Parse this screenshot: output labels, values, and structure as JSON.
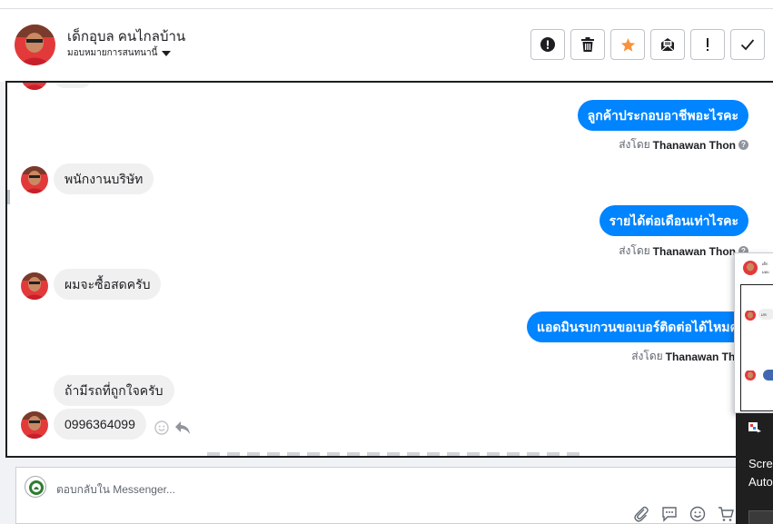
{
  "header": {
    "contact_name": "เด็กอุบล คนไกลบ้าน",
    "assign_label": "มอบหมายการสนทนานี้",
    "actions": [
      {
        "name": "report-spam-button",
        "icon": "exclamation-circle-icon"
      },
      {
        "name": "delete-button",
        "icon": "trash-icon"
      },
      {
        "name": "star-button",
        "icon": "star-icon",
        "color": "#f7923b"
      },
      {
        "name": "mark-unread-button",
        "icon": "envelope-open-icon"
      },
      {
        "name": "follow-up-button",
        "icon": "exclamation-icon"
      },
      {
        "name": "done-button",
        "icon": "checkmark-icon"
      }
    ]
  },
  "messages": [
    {
      "type": "out",
      "text": "ลูกค้าประกอบอาชีพอะไรคะ",
      "sender_prefix": "ส่งโดย",
      "sender_name": "Thanawan Thon"
    },
    {
      "type": "in",
      "text": "พนักงานบริษัท"
    },
    {
      "type": "out",
      "text": "รายได้ต่อเดือนเท่าไรคะ",
      "sender_prefix": "ส่งโดย",
      "sender_name": "Thanawan Thon"
    },
    {
      "type": "in",
      "text": "ผมจะซื้อสดครับ"
    },
    {
      "type": "out",
      "text": "แอดมินรบกวนขอเบอร์ติดต่อได้ไหมคะ",
      "sender_prefix": "ส่งโดย",
      "sender_name": "Thanawan Thon"
    },
    {
      "type": "in",
      "text": "ถ้ามีรถที่ถูกใจครับ"
    },
    {
      "type": "in",
      "text": "0996364099"
    }
  ],
  "composer": {
    "placeholder": "ตอบกลับใน Messenger...",
    "tools": [
      "paperclip-icon",
      "speech-bubble-icon",
      "smiley-icon",
      "cart-icon"
    ]
  },
  "popup": {
    "name_snippet": "เด็ก",
    "sub_snippet": "มอบ",
    "msg_snippet": "เสร"
  },
  "toast": {
    "line1": "Scre",
    "line2": "Auto"
  },
  "colors": {
    "accent": "#0084ff",
    "incoming_bubble": "#f0f0f0",
    "star": "#f7923b"
  }
}
